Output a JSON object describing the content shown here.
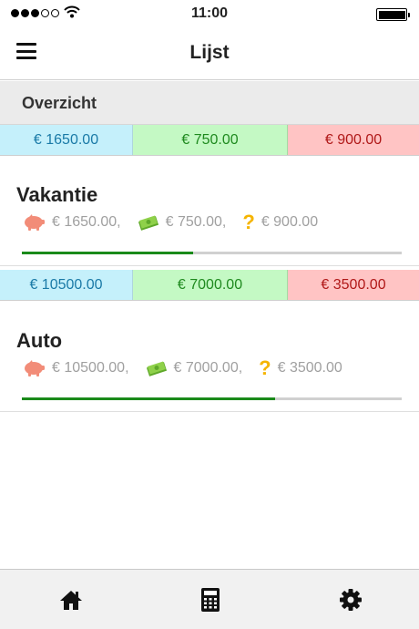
{
  "status_bar": {
    "time": "11:00"
  },
  "nav": {
    "title": "Lijst"
  },
  "overview": {
    "title": "Overzicht",
    "total": "€ 1650.00",
    "saved": "€ 750.00",
    "remaining": "€ 900.00"
  },
  "goals": [
    {
      "name": "Vakantie",
      "strip": {
        "total": "€ 10500.00",
        "saved": "€ 7000.00",
        "remaining": "€ 3500.00"
      },
      "total": "€ 1650.00,",
      "saved": "€ 750.00,",
      "remaining": "€ 900.00",
      "progress": 0.45
    },
    {
      "name": "Auto",
      "total": "€ 10500.00,",
      "saved": "€ 7000.00,",
      "remaining": "€ 3500.00",
      "progress": 0.667
    }
  ],
  "colors": {
    "total": "#c5f0fb",
    "saved": "#c4f9c4",
    "remaining": "#ffc4c4",
    "progress": "#1a8a1a",
    "piggy": "#f28c78",
    "money": "#7cc43c",
    "question": "#f5b400"
  },
  "icons": {
    "menu": "hamburger-menu-icon",
    "total": "piggy-bank-icon",
    "saved": "money-icon",
    "remaining": "question-mark-icon",
    "tabs": [
      "home-icon",
      "calculator-icon",
      "settings-gear-icon"
    ]
  }
}
